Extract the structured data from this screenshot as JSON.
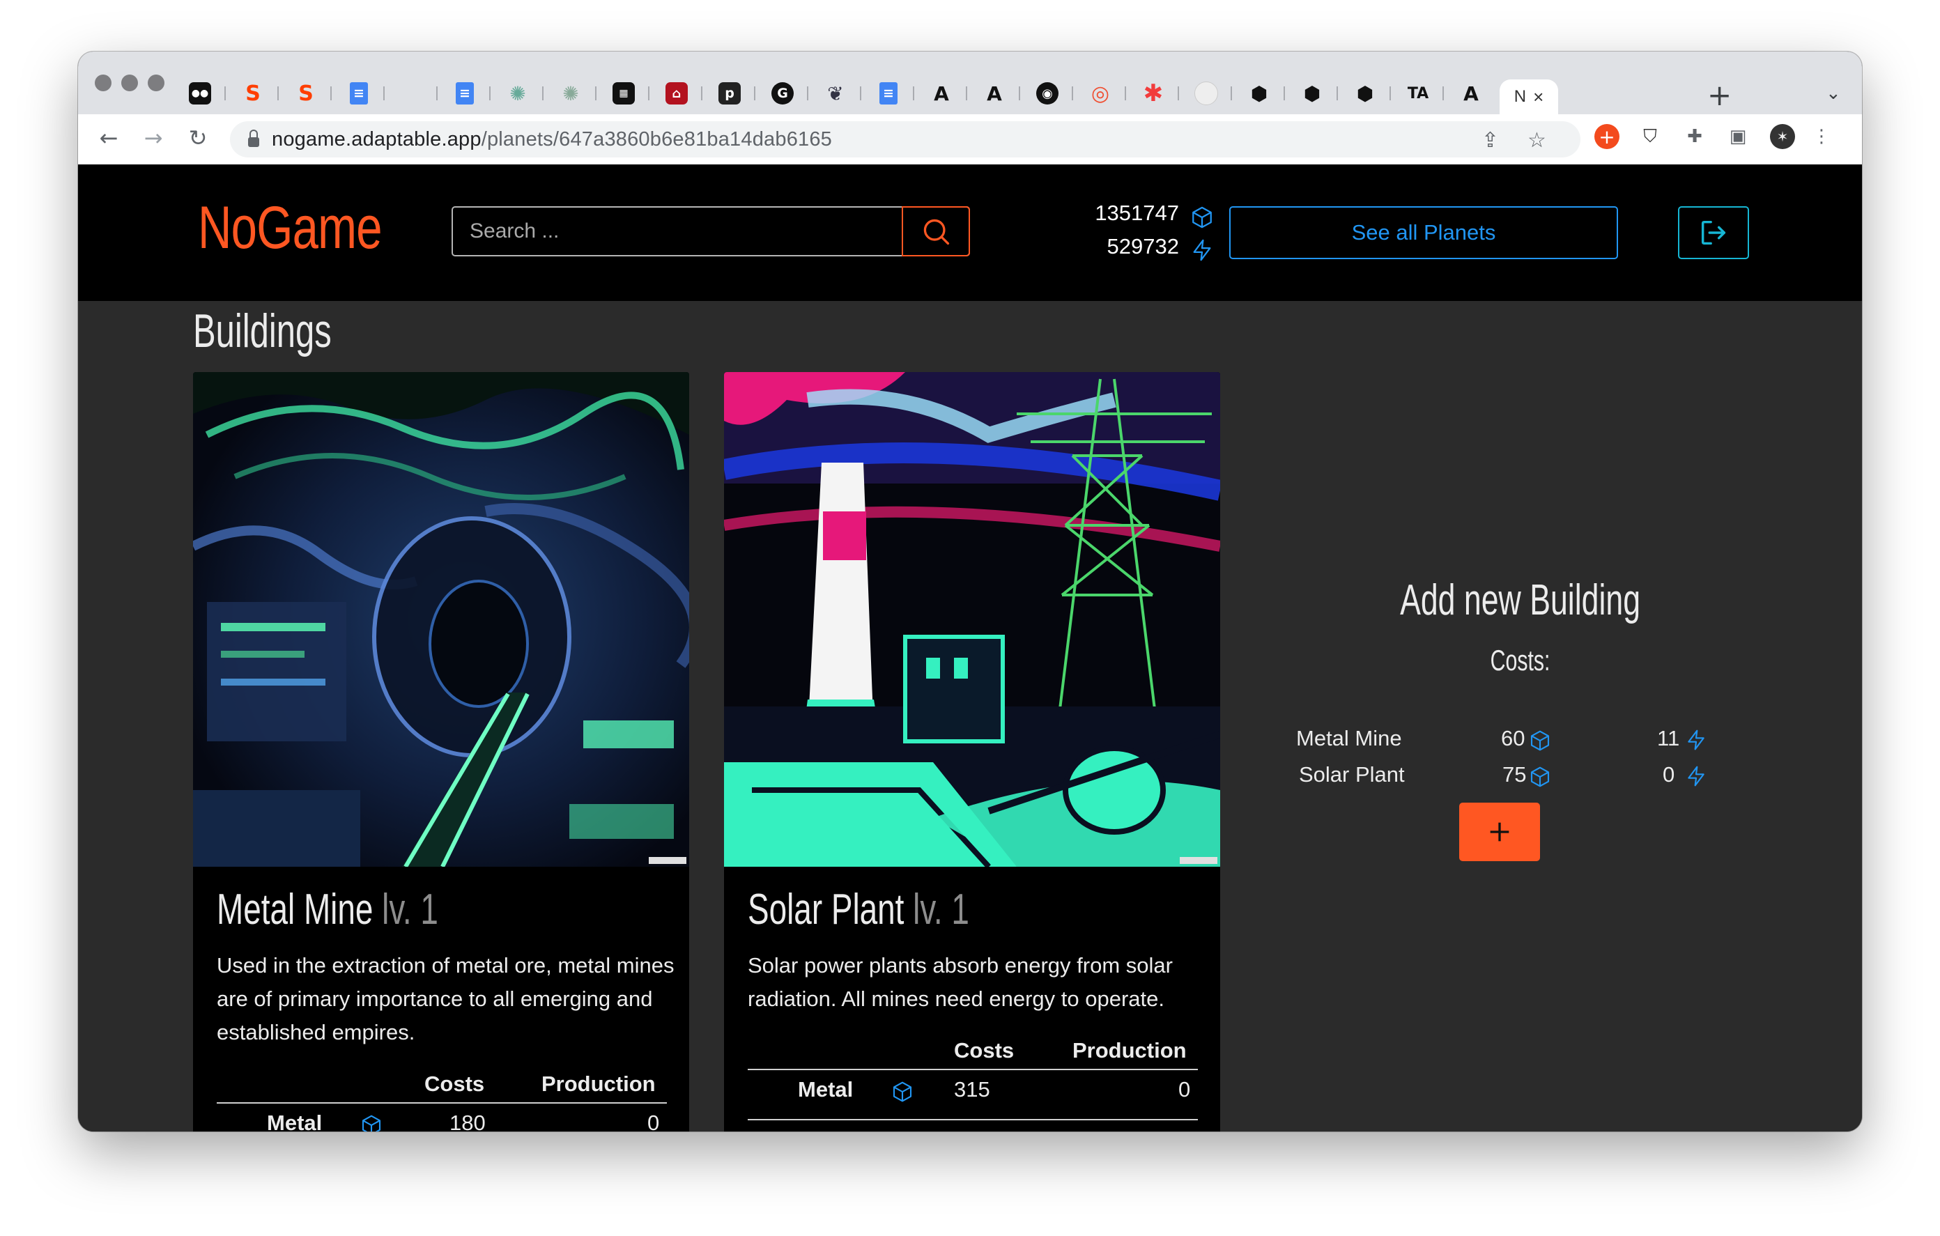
{
  "browser": {
    "url_host": "nogame.adaptable.app",
    "url_path": "/planets/647a3860b6e81ba14dab6165",
    "active_tab_title": "N",
    "tab_favicons": [
      "medium-icon",
      "svelte-icon",
      "svelte-icon",
      "google-docs-icon",
      "blank-icon",
      "google-docs-icon",
      "flower-icon",
      "flower-icon",
      "qr-icon",
      "museum-icon",
      "p-icon",
      "g-icon",
      "brain-icon",
      "google-docs-icon",
      "a-icon",
      "a-icon",
      "github-icon",
      "lifebuoy-icon",
      "asterisk-icon",
      "circle-icon",
      "codepen-icon",
      "codepen-icon",
      "codepen-icon",
      "ta-icon",
      "a-icon"
    ]
  },
  "header": {
    "logo": "NoGame",
    "search_placeholder": "Search ...",
    "metal_amount": "1351747",
    "energy_amount": "529732",
    "planets_button": "See all Planets"
  },
  "buildings": {
    "title": "Buildings",
    "cards": [
      {
        "name": "Metal Mine",
        "level": "lv. 1",
        "description": "Used in the extraction of metal ore, metal mines are of primary importance to all emerging and established empires.",
        "costs_header": "Costs",
        "production_header": "Production",
        "row_label": "Metal",
        "row_cost": "180",
        "row_production": "0"
      },
      {
        "name": "Solar Plant",
        "level": "lv. 1",
        "description": "Solar power plants absorb energy from solar radiation. All mines need energy to operate.",
        "costs_header": "Costs",
        "production_header": "Production",
        "row_label": "Metal",
        "row_cost": "315",
        "row_production": "0"
      }
    ]
  },
  "add_building": {
    "title": "Add new Building",
    "costs_label": "Costs:",
    "rows": [
      {
        "name": "Metal Mine",
        "metal": "60",
        "energy": "11"
      },
      {
        "name": "Solar Plant",
        "metal": "75",
        "energy": "0"
      }
    ]
  },
  "colors": {
    "accent": "#ff5722",
    "link_blue": "#2196f3",
    "cyan": "#16b6d4",
    "header_bg": "#000000",
    "page_bg": "#2b2b2b"
  }
}
